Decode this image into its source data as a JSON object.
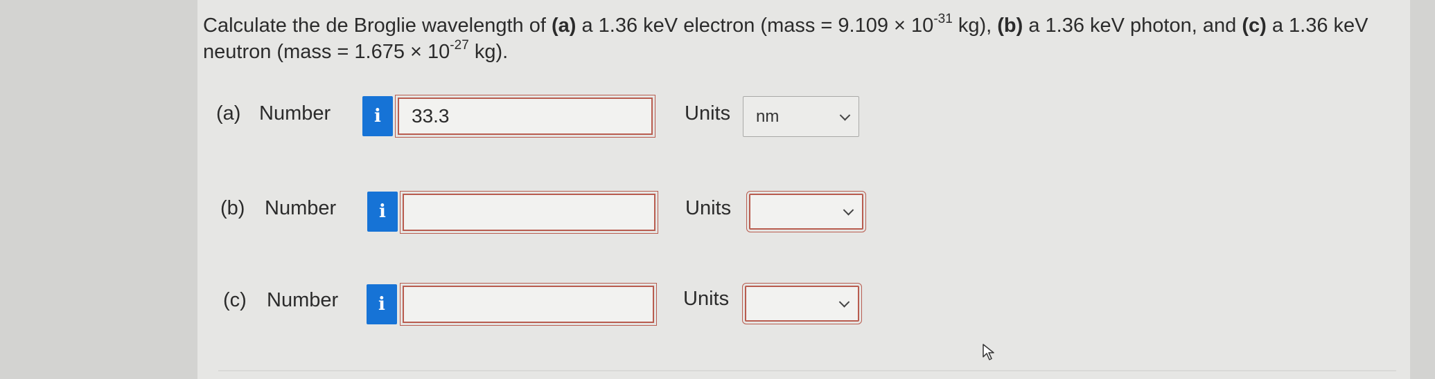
{
  "question": {
    "p1": "Calculate the de Broglie wavelength of ",
    "a_tag": "(a)",
    "p2": " a 1.36 keV electron (mass = 9.109 × 10",
    "exp1": "-31",
    "p3": " kg), ",
    "b_tag": "(b)",
    "p4": " a 1.36 keV photon, and ",
    "c_tag": "(c)",
    "p5": " a 1.36 keV neutron (mass = 1.675 × 10",
    "exp2": "-27",
    "p6": " kg)."
  },
  "rows": [
    {
      "part": "(a)",
      "number_label": "Number",
      "info_icon": "info-icon",
      "value": "33.3",
      "units_label": "Units",
      "units_value": "nm"
    },
    {
      "part": "(b)",
      "number_label": "Number",
      "info_icon": "info-icon",
      "value": "",
      "units_label": "Units",
      "units_value": ""
    },
    {
      "part": "(c)",
      "number_label": "Number",
      "info_icon": "info-icon",
      "value": "",
      "units_label": "Units",
      "units_value": ""
    }
  ],
  "info_glyph": "i",
  "colors": {
    "info_button": "#1673d6",
    "invalid_border": "#b85c4f",
    "card_background": "#e6e6e4"
  }
}
